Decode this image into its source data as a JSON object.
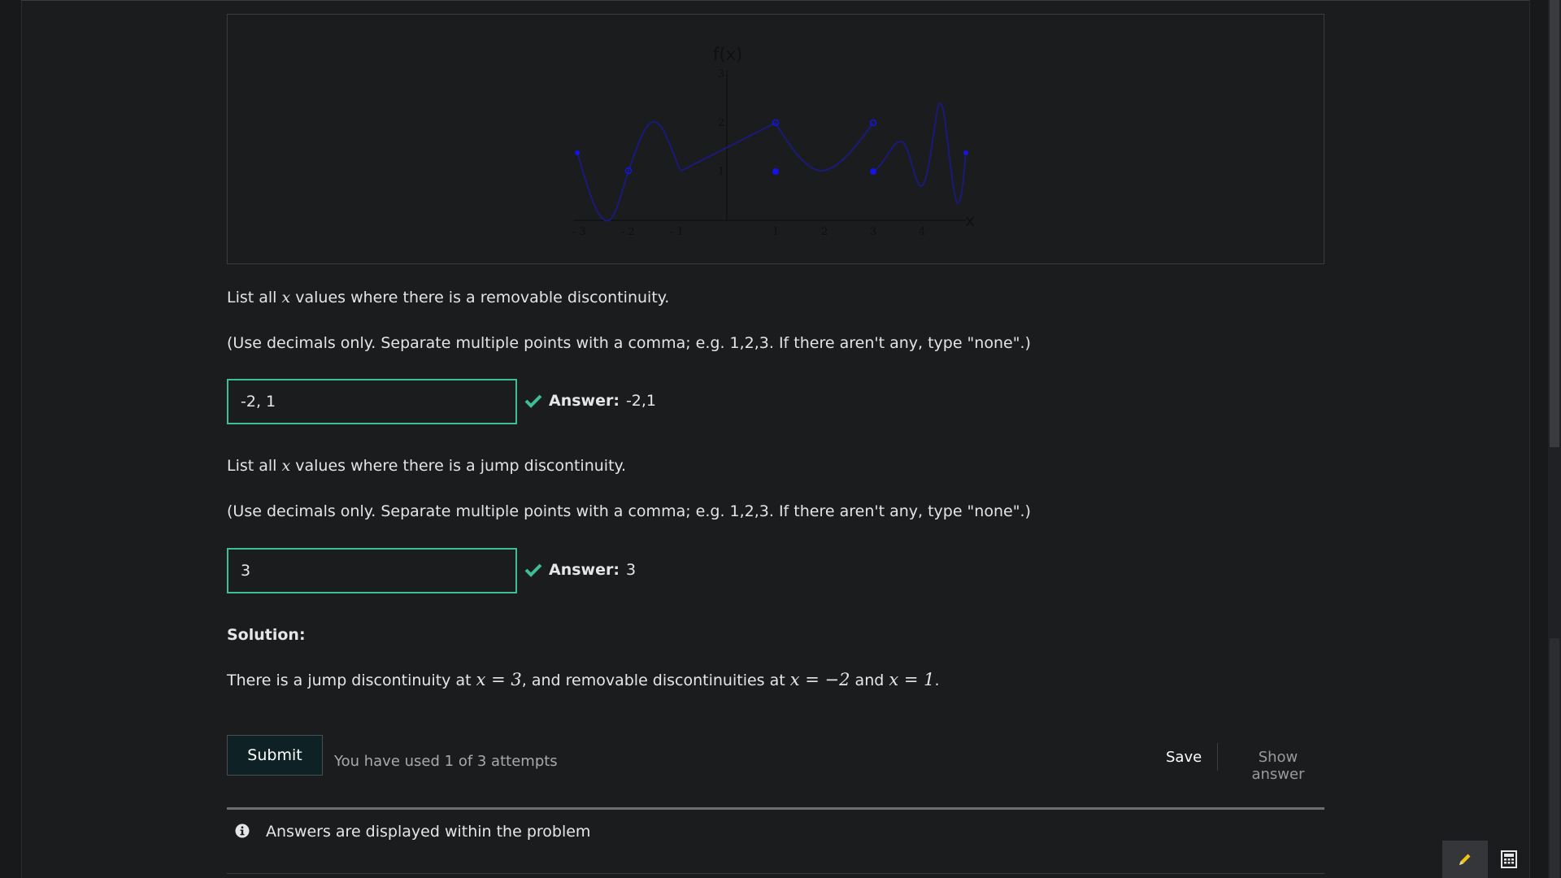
{
  "graph": {
    "y_axis_label": "f(x)",
    "x_axis_label": "x",
    "x_ticks": [
      "- 3",
      "- 2",
      "- 1",
      "1",
      "2",
      "3",
      "4"
    ],
    "y_ticks": [
      "1",
      "2",
      "3"
    ],
    "line_color": "#1a1a7a",
    "point_color": "#1414e6"
  },
  "question1": {
    "prompt_before": "List all",
    "variable": "x",
    "prompt_after": "values where there is a removable discontinuity.",
    "instructions": "(Use decimals only. Separate multiple points with a comma; e.g. 1,2,3. If there aren't any, type \"none\".)",
    "input_value": "-2, 1",
    "answer_label": "Answer:",
    "answer_value": "-2,1"
  },
  "question2": {
    "prompt_before": "List all",
    "variable": "x",
    "prompt_after": "values where there is a jump discontinuity.",
    "instructions": "(Use decimals only. Separate multiple points with a comma; e.g. 1,2,3. If there aren't any, type \"none\".)",
    "input_value": "3",
    "answer_label": "Answer:",
    "answer_value": "3"
  },
  "solution": {
    "heading": "Solution:",
    "text_1": "There is a jump discontinuity at",
    "math_1": "x = 3",
    "text_2": ", and removable discontinuities at",
    "math_2": "x = −2",
    "text_3": "and",
    "math_3": "x = 1",
    "text_4": "."
  },
  "actions": {
    "submit_label": "Submit",
    "attempts_text": "You have used 1 of 3 attempts",
    "save_label": "Save",
    "show_answer_label": "Show answer"
  },
  "notice": {
    "text": "Answers are displayed within the problem"
  },
  "colors": {
    "correct": "#3fbf8f",
    "background": "#1b1c1e"
  },
  "icons": {
    "check": "check-icon",
    "info": "info-icon",
    "pencil": "pencil-icon",
    "calculator": "calculator-icon"
  }
}
